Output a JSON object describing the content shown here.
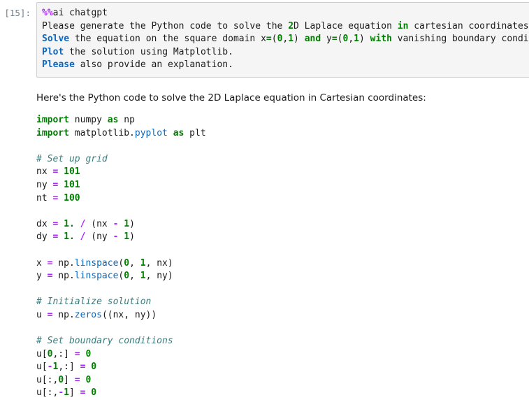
{
  "notebook": {
    "input_cell": {
      "prompt_label": "[15]:",
      "lines": [
        {
          "id": "in-1",
          "tokens": [
            {
              "text": "%%",
              "cls": "t-magic"
            },
            {
              "text": "ai chatgpt",
              "cls": "t-plain"
            }
          ]
        },
        {
          "id": "in-2",
          "tokens": [
            {
              "text": "Please generate the Python code to solve the ",
              "cls": "t-plain"
            },
            {
              "text": "2",
              "cls": "t-num"
            },
            {
              "text": "D Laplace equation ",
              "cls": "t-plain"
            },
            {
              "text": "in",
              "cls": "t-kw"
            },
            {
              "text": " cartesian coordinates.",
              "cls": "t-plain"
            }
          ]
        },
        {
          "id": "in-3",
          "tokens": [
            {
              "text": "Solve",
              "cls": "t-kw-blue"
            },
            {
              "text": " the equation on the square domain x",
              "cls": "t-plain"
            },
            {
              "text": "=",
              "cls": "t-op"
            },
            {
              "text": "(",
              "cls": "t-plain"
            },
            {
              "text": "0",
              "cls": "t-num"
            },
            {
              "text": ",",
              "cls": "t-plain"
            },
            {
              "text": "1",
              "cls": "t-num"
            },
            {
              "text": ") ",
              "cls": "t-plain"
            },
            {
              "text": "and",
              "cls": "t-kw"
            },
            {
              "text": " y",
              "cls": "t-plain"
            },
            {
              "text": "=",
              "cls": "t-op"
            },
            {
              "text": "(",
              "cls": "t-plain"
            },
            {
              "text": "0",
              "cls": "t-num"
            },
            {
              "text": ",",
              "cls": "t-plain"
            },
            {
              "text": "1",
              "cls": "t-num"
            },
            {
              "text": ") ",
              "cls": "t-plain"
            },
            {
              "text": "with",
              "cls": "t-kw"
            },
            {
              "text": " vanishing boundary conditions.",
              "cls": "t-plain"
            }
          ]
        },
        {
          "id": "in-4",
          "tokens": [
            {
              "text": "Plot",
              "cls": "t-kw-blue"
            },
            {
              "text": " the solution using Matplotlib.",
              "cls": "t-plain"
            }
          ]
        },
        {
          "id": "in-5",
          "tokens": [
            {
              "text": "Please",
              "cls": "t-kw-blue"
            },
            {
              "text": " also provide an explanation.",
              "cls": "t-plain"
            }
          ]
        }
      ]
    },
    "output_cell": {
      "paragraph": "Here's the Python code to solve the 2D Laplace equation in Cartesian coordinates:",
      "code_lines": [
        {
          "id": "out-1",
          "tokens": [
            {
              "text": "import",
              "cls": "t-kw"
            },
            {
              "text": " numpy ",
              "cls": "t-plain"
            },
            {
              "text": "as",
              "cls": "t-kw"
            },
            {
              "text": " np",
              "cls": "t-plain"
            }
          ]
        },
        {
          "id": "out-2",
          "tokens": [
            {
              "text": "import",
              "cls": "t-kw"
            },
            {
              "text": " matplotlib.",
              "cls": "t-plain"
            },
            {
              "text": "pyplot",
              "cls": "t-fn"
            },
            {
              "text": " ",
              "cls": "t-plain"
            },
            {
              "text": "as",
              "cls": "t-kw"
            },
            {
              "text": " plt",
              "cls": "t-plain"
            }
          ]
        },
        {
          "id": "out-3",
          "tokens": []
        },
        {
          "id": "out-4",
          "tokens": [
            {
              "text": "# Set up grid",
              "cls": "t-comment"
            }
          ]
        },
        {
          "id": "out-5",
          "tokens": [
            {
              "text": "nx ",
              "cls": "t-plain"
            },
            {
              "text": "=",
              "cls": "t-op-pur"
            },
            {
              "text": " ",
              "cls": "t-plain"
            },
            {
              "text": "101",
              "cls": "t-num"
            }
          ]
        },
        {
          "id": "out-6",
          "tokens": [
            {
              "text": "ny ",
              "cls": "t-plain"
            },
            {
              "text": "=",
              "cls": "t-op-pur"
            },
            {
              "text": " ",
              "cls": "t-plain"
            },
            {
              "text": "101",
              "cls": "t-num"
            }
          ]
        },
        {
          "id": "out-7",
          "tokens": [
            {
              "text": "nt ",
              "cls": "t-plain"
            },
            {
              "text": "=",
              "cls": "t-op-pur"
            },
            {
              "text": " ",
              "cls": "t-plain"
            },
            {
              "text": "100",
              "cls": "t-num"
            }
          ]
        },
        {
          "id": "out-8",
          "tokens": []
        },
        {
          "id": "out-9",
          "tokens": [
            {
              "text": "dx ",
              "cls": "t-plain"
            },
            {
              "text": "=",
              "cls": "t-op-pur"
            },
            {
              "text": " ",
              "cls": "t-plain"
            },
            {
              "text": "1.",
              "cls": "t-num"
            },
            {
              "text": " ",
              "cls": "t-plain"
            },
            {
              "text": "/",
              "cls": "t-op-pur"
            },
            {
              "text": " (nx ",
              "cls": "t-plain"
            },
            {
              "text": "-",
              "cls": "t-op-pur"
            },
            {
              "text": " ",
              "cls": "t-plain"
            },
            {
              "text": "1",
              "cls": "t-num"
            },
            {
              "text": ")",
              "cls": "t-plain"
            }
          ]
        },
        {
          "id": "out-10",
          "tokens": [
            {
              "text": "dy ",
              "cls": "t-plain"
            },
            {
              "text": "=",
              "cls": "t-op-pur"
            },
            {
              "text": " ",
              "cls": "t-plain"
            },
            {
              "text": "1.",
              "cls": "t-num"
            },
            {
              "text": " ",
              "cls": "t-plain"
            },
            {
              "text": "/",
              "cls": "t-op-pur"
            },
            {
              "text": " (ny ",
              "cls": "t-plain"
            },
            {
              "text": "-",
              "cls": "t-op-pur"
            },
            {
              "text": " ",
              "cls": "t-plain"
            },
            {
              "text": "1",
              "cls": "t-num"
            },
            {
              "text": ")",
              "cls": "t-plain"
            }
          ]
        },
        {
          "id": "out-11",
          "tokens": []
        },
        {
          "id": "out-12",
          "tokens": [
            {
              "text": "x ",
              "cls": "t-plain"
            },
            {
              "text": "=",
              "cls": "t-op-pur"
            },
            {
              "text": " np.",
              "cls": "t-plain"
            },
            {
              "text": "linspace",
              "cls": "t-fn"
            },
            {
              "text": "(",
              "cls": "t-plain"
            },
            {
              "text": "0",
              "cls": "t-num"
            },
            {
              "text": ", ",
              "cls": "t-plain"
            },
            {
              "text": "1",
              "cls": "t-num"
            },
            {
              "text": ", nx)",
              "cls": "t-plain"
            }
          ]
        },
        {
          "id": "out-13",
          "tokens": [
            {
              "text": "y ",
              "cls": "t-plain"
            },
            {
              "text": "=",
              "cls": "t-op-pur"
            },
            {
              "text": " np.",
              "cls": "t-plain"
            },
            {
              "text": "linspace",
              "cls": "t-fn"
            },
            {
              "text": "(",
              "cls": "t-plain"
            },
            {
              "text": "0",
              "cls": "t-num"
            },
            {
              "text": ", ",
              "cls": "t-plain"
            },
            {
              "text": "1",
              "cls": "t-num"
            },
            {
              "text": ", ny)",
              "cls": "t-plain"
            }
          ]
        },
        {
          "id": "out-14",
          "tokens": []
        },
        {
          "id": "out-15",
          "tokens": [
            {
              "text": "# Initialize solution",
              "cls": "t-comment"
            }
          ]
        },
        {
          "id": "out-16",
          "tokens": [
            {
              "text": "u ",
              "cls": "t-plain"
            },
            {
              "text": "=",
              "cls": "t-op-pur"
            },
            {
              "text": " np.",
              "cls": "t-plain"
            },
            {
              "text": "zeros",
              "cls": "t-fn"
            },
            {
              "text": "((nx, ny))",
              "cls": "t-plain"
            }
          ]
        },
        {
          "id": "out-17",
          "tokens": []
        },
        {
          "id": "out-18",
          "tokens": [
            {
              "text": "# Set boundary conditions",
              "cls": "t-comment"
            }
          ]
        },
        {
          "id": "out-19",
          "tokens": [
            {
              "text": "u[",
              "cls": "t-plain"
            },
            {
              "text": "0",
              "cls": "t-num"
            },
            {
              "text": ",:] ",
              "cls": "t-plain"
            },
            {
              "text": "=",
              "cls": "t-op-pur"
            },
            {
              "text": " ",
              "cls": "t-plain"
            },
            {
              "text": "0",
              "cls": "t-num"
            }
          ]
        },
        {
          "id": "out-20",
          "tokens": [
            {
              "text": "u[",
              "cls": "t-plain"
            },
            {
              "text": "-",
              "cls": "t-op-pur"
            },
            {
              "text": "1",
              "cls": "t-num"
            },
            {
              "text": ",:] ",
              "cls": "t-plain"
            },
            {
              "text": "=",
              "cls": "t-op-pur"
            },
            {
              "text": " ",
              "cls": "t-plain"
            },
            {
              "text": "0",
              "cls": "t-num"
            }
          ]
        },
        {
          "id": "out-21",
          "tokens": [
            {
              "text": "u[:,",
              "cls": "t-plain"
            },
            {
              "text": "0",
              "cls": "t-num"
            },
            {
              "text": "] ",
              "cls": "t-plain"
            },
            {
              "text": "=",
              "cls": "t-op-pur"
            },
            {
              "text": " ",
              "cls": "t-plain"
            },
            {
              "text": "0",
              "cls": "t-num"
            }
          ]
        },
        {
          "id": "out-22",
          "tokens": [
            {
              "text": "u[:,",
              "cls": "t-plain"
            },
            {
              "text": "-",
              "cls": "t-op-pur"
            },
            {
              "text": "1",
              "cls": "t-num"
            },
            {
              "text": "] ",
              "cls": "t-plain"
            },
            {
              "text": "=",
              "cls": "t-op-pur"
            },
            {
              "text": " ",
              "cls": "t-plain"
            },
            {
              "text": "0",
              "cls": "t-num"
            }
          ]
        }
      ]
    }
  },
  "colors": {
    "page_background": "#ffffff",
    "input_cell_background": "#f5f5f5",
    "input_cell_border": "#cfcfcf",
    "prompt_text": "#707b8c",
    "keyword_green": "#008000",
    "keyword_blue": "#0a68c1",
    "operator_purple": "#aa22ff",
    "comment_teal": "#3d7b7b",
    "plain_text": "#1a1a1a"
  }
}
